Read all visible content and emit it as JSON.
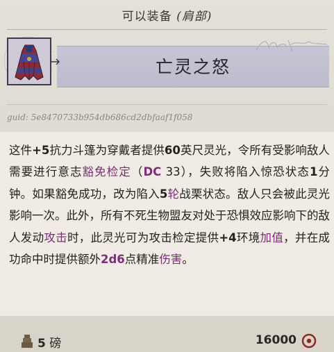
{
  "header": {
    "title_prefix": "可以装备",
    "title_slot": "(肩部)"
  },
  "item": {
    "name": "亡灵之怒",
    "signature": "Anne Pratt",
    "guid": "guid: 5e8470733b954db686cd2dbfaaf1f058"
  },
  "description": {
    "segments": [
      {
        "t": "这件",
        "s": ""
      },
      {
        "t": "+5",
        "s": "bold"
      },
      {
        "t": "抗力斗篷为穿戴者提供",
        "s": ""
      },
      {
        "t": "60",
        "s": "bold"
      },
      {
        "t": "英尺灵光，令所有受影响敌人需要进行意志",
        "s": ""
      },
      {
        "t": "豁免检定",
        "s": "kw"
      },
      {
        "t": "（",
        "s": ""
      },
      {
        "t": "DC",
        "s": "kw bold"
      },
      {
        "t": " 33）",
        "s": ""
      },
      {
        "t": "，失败将陷入惊恐状态",
        "s": ""
      },
      {
        "t": "1",
        "s": "bold"
      },
      {
        "t": "分钟。如果豁免成功，改为陷入",
        "s": ""
      },
      {
        "t": "5",
        "s": "bold"
      },
      {
        "t": "轮",
        "s": "kw"
      },
      {
        "t": "战栗状态。敌人只会被此灵光影响一次。此外，所有不死生物盟友对处于恐惧效应影响下的敌人发动",
        "s": ""
      },
      {
        "t": "攻击",
        "s": "kw"
      },
      {
        "t": "时，此灵光可为攻击检定提供",
        "s": ""
      },
      {
        "t": "+4",
        "s": "bold"
      },
      {
        "t": "环境",
        "s": ""
      },
      {
        "t": "加值",
        "s": "kw"
      },
      {
        "t": "，并在成功命中时提供额外",
        "s": ""
      },
      {
        "t": "2d6",
        "s": "kw bold"
      },
      {
        "t": "点精准",
        "s": ""
      },
      {
        "t": "伤害",
        "s": "kw"
      },
      {
        "t": "。",
        "s": ""
      }
    ]
  },
  "footer": {
    "weight_value": "5",
    "weight_unit": "磅",
    "price": "16000"
  },
  "colors": {
    "keyword": "#7b2d78",
    "title_bar": "#c6c5d4"
  },
  "icons": {
    "item": "cloak-icon",
    "weight": "weight-icon",
    "currency": "coin-icon"
  }
}
